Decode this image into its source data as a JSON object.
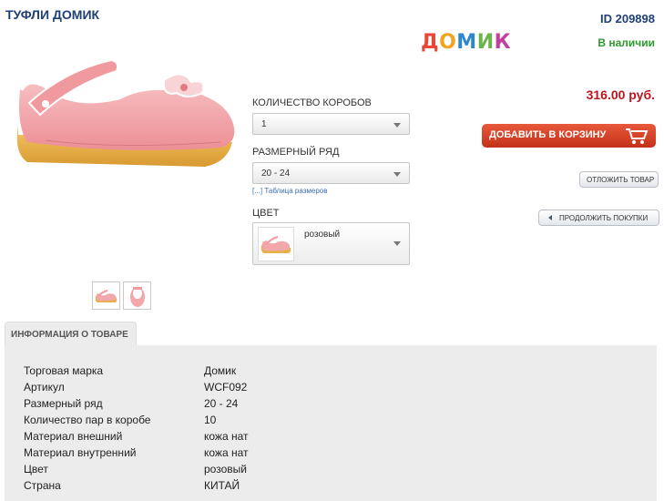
{
  "product": {
    "title": "ТУФЛИ ДОМИК",
    "id_text": "ID 209898",
    "brand_logo_letters": [
      "Д",
      "О",
      "М",
      "И",
      "К"
    ],
    "brand_logo_colors": [
      "#e8473a",
      "#f2a51c",
      "#2f86d0",
      "#6ab54a",
      "#c43ea0"
    ],
    "availability": "В наличии",
    "price": "316.00 руб."
  },
  "options": {
    "boxes_label": "КОЛИЧЕСТВО КОРОБОВ",
    "boxes_value": "1",
    "size_label": "РАЗМЕРНЫЙ РЯД",
    "size_value": "20 - 24",
    "size_table_link": "[...] Таблица размеров",
    "color_label": "ЦВЕТ",
    "color_value": "розовый"
  },
  "actions": {
    "add_to_cart": "ДОБАВИТЬ В КОРЗИНУ",
    "postpone": "ОТЛОЖИТЬ ТОВАР",
    "continue_shopping": "ПРОДОЛЖИТЬ ПОКУПКИ"
  },
  "info": {
    "tab_label": "ИНФОРМАЦИЯ О ТОВАРЕ",
    "rows": [
      {
        "key": "Торговая марка",
        "value": "Домик"
      },
      {
        "key": "Артикул",
        "value": "WCF092"
      },
      {
        "key": "Размерный ряд",
        "value": "20 - 24"
      },
      {
        "key": "Количество пар в коробе",
        "value": "10"
      },
      {
        "key": "Материал внешний",
        "value": "кожа нат"
      },
      {
        "key": "Материал внутренний",
        "value": "кожа нат"
      },
      {
        "key": "Цвет",
        "value": "розовый"
      },
      {
        "key": "Страна",
        "value": "КИТАЙ"
      }
    ]
  },
  "colors": {
    "title": "#1f3f78",
    "stock": "#2e9a2e",
    "price": "#c0141d",
    "cart_button": "#d4401f",
    "shoe_pink": "#f2a7ab",
    "sole": "#e8b04a"
  }
}
